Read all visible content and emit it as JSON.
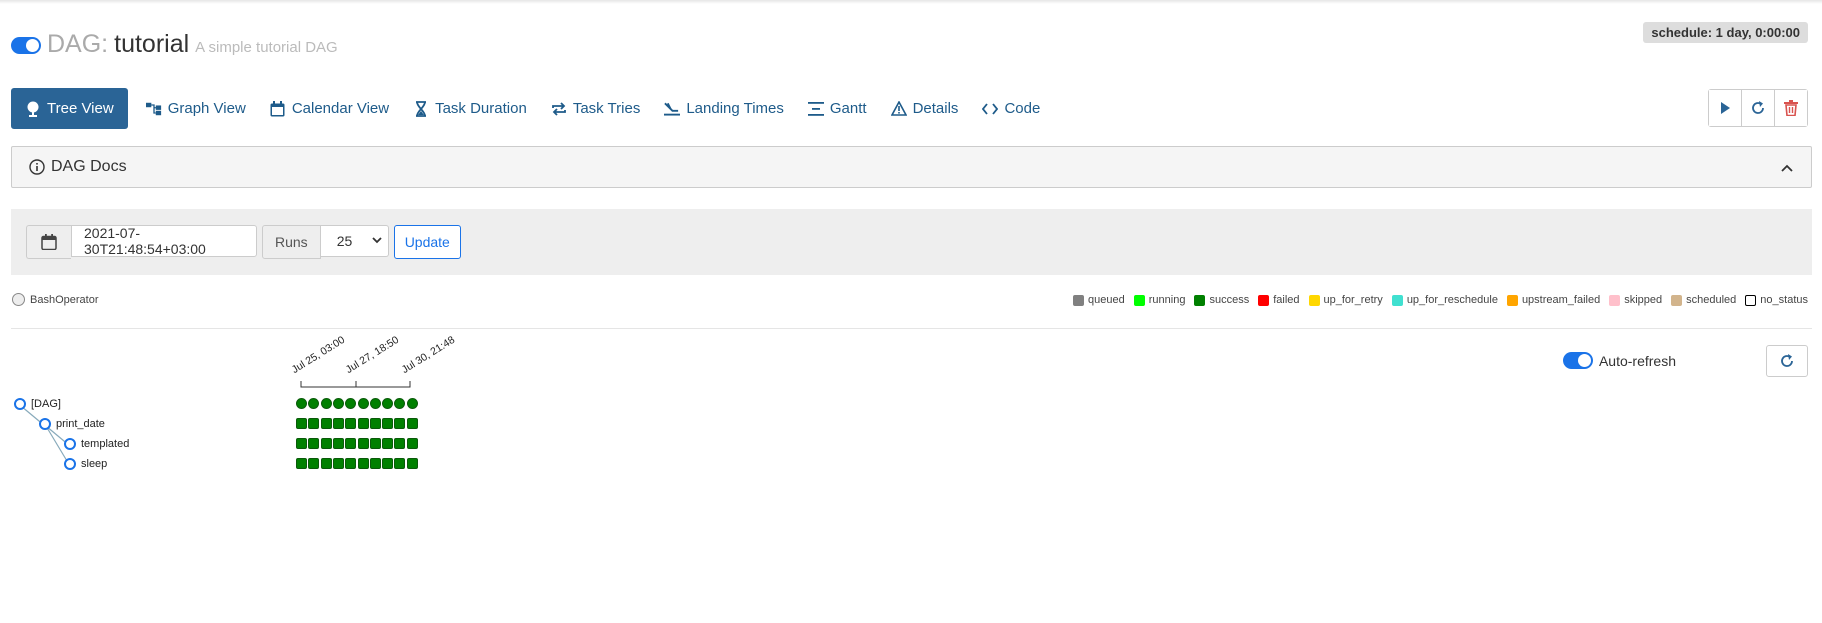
{
  "header": {
    "dag_prefix": "DAG:",
    "dag_name": "tutorial",
    "dag_description": "A simple tutorial DAG",
    "schedule": "schedule: 1 day, 0:00:00",
    "paused_toggle": "on"
  },
  "tabs": [
    {
      "label": "Tree View",
      "icon": "tree-icon",
      "active": true
    },
    {
      "label": "Graph View",
      "icon": "graph-icon"
    },
    {
      "label": "Calendar View",
      "icon": "calendar-icon"
    },
    {
      "label": "Task Duration",
      "icon": "hourglass-icon"
    },
    {
      "label": "Task Tries",
      "icon": "retry-icon"
    },
    {
      "label": "Landing Times",
      "icon": "landing-icon"
    },
    {
      "label": "Gantt",
      "icon": "gantt-icon"
    },
    {
      "label": "Details",
      "icon": "warning-triangle-icon"
    },
    {
      "label": "Code",
      "icon": "code-icon"
    }
  ],
  "actions": [
    "play-icon",
    "refresh-icon",
    "trash-icon"
  ],
  "docs": {
    "title": "DAG Docs"
  },
  "form": {
    "base_date": "2021-07-30T21:48:54+03:00",
    "runs_label": "Runs",
    "runs_value": "25",
    "update_label": "Update"
  },
  "operator": {
    "label": "BashOperator",
    "color": "#ededed"
  },
  "legend": [
    {
      "label": "queued",
      "color": "#808080"
    },
    {
      "label": "running",
      "color": "#00ff00"
    },
    {
      "label": "success",
      "color": "#008000"
    },
    {
      "label": "failed",
      "color": "#ff0000"
    },
    {
      "label": "up_for_retry",
      "color": "#ffd700"
    },
    {
      "label": "up_for_reschedule",
      "color": "#40e0d0"
    },
    {
      "label": "upstream_failed",
      "color": "#ffa500"
    },
    {
      "label": "skipped",
      "color": "#ffc0cb"
    },
    {
      "label": "scheduled",
      "color": "#d2b48c"
    },
    {
      "label": "no_status",
      "color": "#ffffff"
    }
  ],
  "auto_refresh": {
    "label": "Auto-refresh",
    "enabled": true
  },
  "tree": {
    "dates": [
      "Jul 25, 03:00",
      "Jul 27, 18:50",
      "Jul 30, 21:48"
    ],
    "nodes": [
      {
        "label": "[DAG]",
        "depth": 0,
        "kind": "dag"
      },
      {
        "label": "print_date",
        "depth": 1,
        "kind": "task"
      },
      {
        "label": "templated",
        "depth": 2,
        "kind": "task"
      },
      {
        "label": "sleep",
        "depth": 2,
        "kind": "task"
      }
    ],
    "run_count": 10,
    "state": "success"
  }
}
